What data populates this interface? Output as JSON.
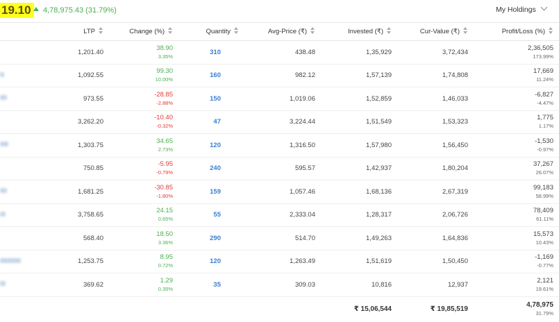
{
  "header": {
    "pl_value": "19.10",
    "pl_change": "4,78,975.43 (31.79%)",
    "holdings_label": "My Holdings"
  },
  "columns": [
    "LTP",
    "Change (%)",
    "Quantity",
    "Avg-Price (₹)",
    "Invested (₹)",
    "Cur-Value (₹)",
    "Profit/Loss (%)"
  ],
  "rows": [
    {
      "ltp": "1,201.40",
      "chg": "38.90",
      "chg_pct": "3.35%",
      "dir": "pos",
      "qty": "310",
      "avg": "438.48",
      "inv": "1,35,929",
      "cur": "3,72,434",
      "pl": "2,36,505",
      "pl_pct": "173.99%"
    },
    {
      "ltp": "1,092.55",
      "chg": "99.30",
      "chg_pct": "10.00%",
      "dir": "pos",
      "qty": "160",
      "avg": "982.12",
      "inv": "1,57,139",
      "cur": "1,74,808",
      "pl": "17,669",
      "pl_pct": "11.24%"
    },
    {
      "ltp": "973.55",
      "chg": "-28.85",
      "chg_pct": "-2.88%",
      "dir": "neg",
      "qty": "150",
      "avg": "1,019.06",
      "inv": "1,52,859",
      "cur": "1,46,033",
      "pl": "-6,827",
      "pl_pct": "-4.47%"
    },
    {
      "ltp": "3,262.20",
      "chg": "-10.40",
      "chg_pct": "-0.32%",
      "dir": "neg",
      "qty": "47",
      "avg": "3,224.44",
      "inv": "1,51,549",
      "cur": "1,53,323",
      "pl": "1,775",
      "pl_pct": "1.17%"
    },
    {
      "ltp": "1,303.75",
      "chg": "34.65",
      "chg_pct": "2.73%",
      "dir": "pos",
      "qty": "120",
      "avg": "1,316.50",
      "inv": "1,57,980",
      "cur": "1,56,450",
      "pl": "-1,530",
      "pl_pct": "-0.97%"
    },
    {
      "ltp": "750.85",
      "chg": "-5.95",
      "chg_pct": "-0.79%",
      "dir": "neg",
      "qty": "240",
      "avg": "595.57",
      "inv": "1,42,937",
      "cur": "1,80,204",
      "pl": "37,267",
      "pl_pct": "26.07%"
    },
    {
      "ltp": "1,681.25",
      "chg": "-30.85",
      "chg_pct": "-1.80%",
      "dir": "neg",
      "qty": "159",
      "avg": "1,057.46",
      "inv": "1,68,136",
      "cur": "2,67,319",
      "pl": "99,183",
      "pl_pct": "58.99%"
    },
    {
      "ltp": "3,758.65",
      "chg": "24.15",
      "chg_pct": "0.65%",
      "dir": "pos",
      "qty": "55",
      "avg": "2,333.04",
      "inv": "1,28,317",
      "cur": "2,06,726",
      "pl": "78,409",
      "pl_pct": "61.11%"
    },
    {
      "ltp": "568.40",
      "chg": "18.50",
      "chg_pct": "3.36%",
      "dir": "pos",
      "qty": "290",
      "avg": "514.70",
      "inv": "1,49,263",
      "cur": "1,64,836",
      "pl": "15,573",
      "pl_pct": "10.43%"
    },
    {
      "ltp": "1,253.75",
      "chg": "8.95",
      "chg_pct": "0.72%",
      "dir": "pos",
      "qty": "120",
      "avg": "1,263.49",
      "inv": "1,51,619",
      "cur": "1,50,450",
      "pl": "-1,169",
      "pl_pct": "-0.77%"
    },
    {
      "ltp": "369.62",
      "chg": "1.29",
      "chg_pct": "0.35%",
      "dir": "pos",
      "qty": "35",
      "avg": "309.03",
      "inv": "10,816",
      "cur": "12,937",
      "pl": "2,121",
      "pl_pct": "19.61%"
    }
  ],
  "totals": {
    "invested": "₹ 15,06,544",
    "current": "₹ 19,85,519",
    "pl": "4,78,975",
    "pl_pct": "31.79%"
  },
  "colors": {
    "positive": "#4caf50",
    "negative": "#e53935",
    "quantity": "#387ed1",
    "highlight": "#ffff1f"
  }
}
